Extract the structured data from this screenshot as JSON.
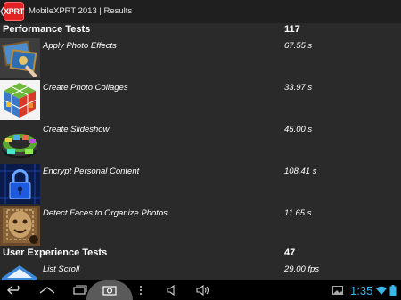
{
  "actionbar": {
    "logo_text": "XPRT",
    "title": "MobileXPRT 2013 | Results"
  },
  "performance": {
    "title": "Performance Tests",
    "score": "117",
    "items": [
      {
        "label": "Apply Photo Effects",
        "value": "67.55 s",
        "icon": "photo-effects-icon"
      },
      {
        "label": "Create Photo Collages",
        "value": "33.97 s",
        "icon": "photo-collage-icon"
      },
      {
        "label": "Create Slideshow",
        "value": "45.00 s",
        "icon": "slideshow-icon"
      },
      {
        "label": "Encrypt Personal Content",
        "value": "108.41 s",
        "icon": "padlock-icon"
      },
      {
        "label": "Detect Faces to Organize Photos",
        "value": "11.65 s",
        "icon": "face-detect-icon"
      }
    ]
  },
  "user_experience": {
    "title": "User Experience Tests",
    "score": "47",
    "items": [
      {
        "label": "List Scroll",
        "value": "29.00 fps",
        "icon": "list-scroll-icon"
      }
    ]
  },
  "statusbar": {
    "clock": "1:35"
  },
  "colors": {
    "background": "#2a2a2a",
    "logo_red": "#e02424",
    "clock_blue": "#38b6e8"
  }
}
